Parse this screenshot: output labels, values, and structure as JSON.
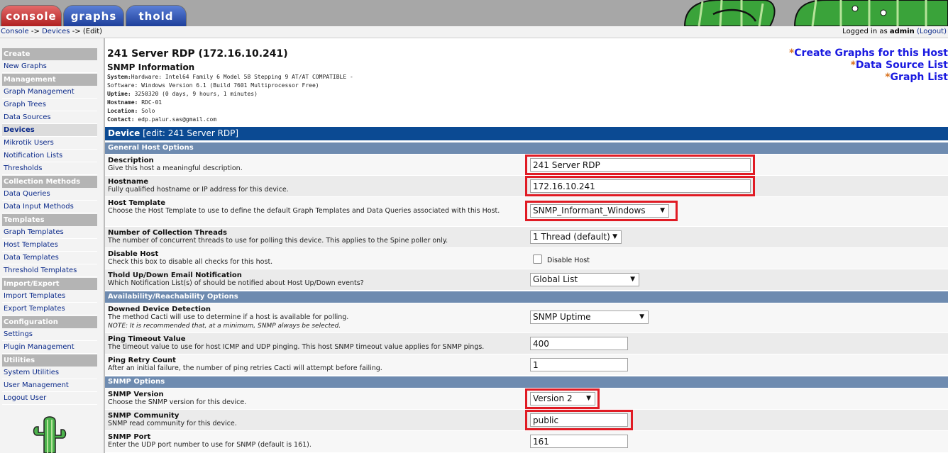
{
  "tabs": {
    "console": "console",
    "graphs": "graphs",
    "thold": "thold"
  },
  "breadcrumb": {
    "console": "Console",
    "sep1": "->",
    "devices": "Devices",
    "sep2": "->",
    "current": "(Edit)"
  },
  "login": {
    "prefix": "Logged in as",
    "user": "admin",
    "logout": "(Logout)"
  },
  "sidebar": {
    "create": {
      "head": "Create",
      "items": [
        "New Graphs"
      ]
    },
    "management": {
      "head": "Management",
      "items": [
        "Graph Management",
        "Graph Trees",
        "Data Sources",
        "Devices",
        "Mikrotik Users",
        "Notification Lists",
        "Thresholds"
      ]
    },
    "collection": {
      "head": "Collection Methods",
      "items": [
        "Data Queries",
        "Data Input Methods"
      ]
    },
    "templates": {
      "head": "Templates",
      "items": [
        "Graph Templates",
        "Host Templates",
        "Data Templates",
        "Threshold Templates"
      ]
    },
    "importexport": {
      "head": "Import/Export",
      "items": [
        "Import Templates",
        "Export Templates"
      ]
    },
    "configuration": {
      "head": "Configuration",
      "items": [
        "Settings",
        "Plugin Management"
      ]
    },
    "utilities": {
      "head": "Utilities",
      "items": [
        "System Utilities",
        "User Management",
        "Logout User"
      ]
    },
    "active_item": "Devices"
  },
  "device": {
    "title": "241 Server RDP (172.16.10.241)"
  },
  "snmp_info": {
    "title": "SNMP Information",
    "system_label": "System:",
    "system_value": "Hardware: Intel64 Family 6 Model 58 Stepping 9 AT/AT COMPATIBLE -",
    "system_value2": "Software: Windows Version 6.1 (Build 7601 Multiprocessor Free)",
    "uptime_label": "Uptime:",
    "uptime_value": "3250320 (0 days, 9 hours, 1 minutes)",
    "hostname_label": "Hostname:",
    "hostname_value": "RDC-01",
    "location_label": "Location:",
    "location_value": "Solo",
    "contact_label": "Contact:",
    "contact_value": "edp.palur.sas@gmail.com"
  },
  "quicklinks": {
    "star": "*",
    "create_graphs": "Create Graphs for this Host",
    "data_source_list": "Data Source List",
    "graph_list": "Graph List"
  },
  "form": {
    "header_bold": "Device",
    "header_rest": "[edit: 241 Server RDP]",
    "sections": {
      "general": "General Host Options",
      "availability": "Availability/Reachability Options",
      "snmp": "SNMP Options"
    },
    "description": {
      "title": "Description",
      "desc": "Give this host a meaningful description.",
      "value": "241 Server RDP"
    },
    "hostname": {
      "title": "Hostname",
      "desc": "Fully qualified hostname or IP address for this device.",
      "value": "172.16.10.241"
    },
    "host_template": {
      "title": "Host Template",
      "desc": "Choose the Host Template to use to define the default Graph Templates and Data Queries associated with this Host.",
      "value": "SNMP_Informant_Windows"
    },
    "threads": {
      "title": "Number of Collection Threads",
      "desc": "The number of concurrent threads to use for polling this device. This applies to the Spine poller only.",
      "value": "1 Thread (default)"
    },
    "disable": {
      "title": "Disable Host",
      "desc": "Check this box to disable all checks for this host.",
      "checkbox_label": "Disable Host",
      "checked": false
    },
    "thold": {
      "title": "Thold Up/Down Email Notification",
      "desc": "Which Notification List(s) of should be notified about Host Up/Down events?",
      "value": "Global List"
    },
    "downed": {
      "title": "Downed Device Detection",
      "desc": "The method Cacti will use to determine if a host is available for polling.",
      "note": "NOTE: It is recommended that, at a minimum, SNMP always be selected.",
      "value": "SNMP Uptime"
    },
    "ping_timeout": {
      "title": "Ping Timeout Value",
      "desc": "The timeout value to use for host ICMP and UDP pinging. This host SNMP timeout value applies for SNMP pings.",
      "value": "400"
    },
    "ping_retry": {
      "title": "Ping Retry Count",
      "desc": "After an initial failure, the number of ping retries Cacti will attempt before failing.",
      "value": "1"
    },
    "snmp_version": {
      "title": "SNMP Version",
      "desc": "Choose the SNMP version for this device.",
      "value": "Version 2"
    },
    "snmp_community": {
      "title": "SNMP Community",
      "desc": "SNMP read community for this device.",
      "value": "public"
    },
    "snmp_port": {
      "title": "SNMP Port",
      "desc": "Enter the UDP port number to use for SNMP (default is 161).",
      "value": "161"
    }
  },
  "colors": {
    "header_blue": "#0b4a93",
    "section_blue": "#6e8bb0",
    "highlight_red": "#e01b24",
    "link_blue": "#0b2a8a"
  },
  "icons": [
    "cactus-banner-icon",
    "cactus-logo-icon",
    "chevron-down-icon"
  ]
}
